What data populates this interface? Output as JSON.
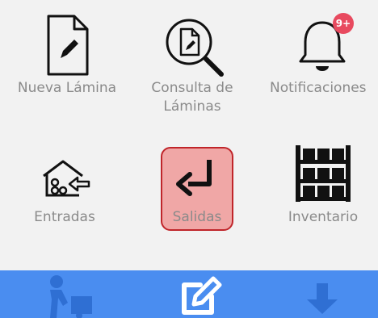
{
  "menu": {
    "nueva_lamina": {
      "label": "Nueva Lámina"
    },
    "consulta_laminas": {
      "label_line1": "Consulta de",
      "label_line2": "Láminas"
    },
    "notificaciones": {
      "label": "Notificaciones",
      "badge": "9+"
    },
    "entradas": {
      "label": "Entradas"
    },
    "salidas": {
      "label": "Salidas"
    },
    "inventario": {
      "label": "Inventario"
    }
  },
  "bottom_nav": {
    "items": [
      {
        "icon": "delivery-person-icon"
      },
      {
        "icon": "edit-icon"
      },
      {
        "icon": "download-icon"
      }
    ]
  },
  "colors": {
    "background": "#f2f2f2",
    "bottom_bar": "#4a8df0",
    "selected_fill": "#f0a7a6",
    "selected_border": "#c0252a",
    "badge": "#e84a5f",
    "label": "#8a8a8a"
  }
}
